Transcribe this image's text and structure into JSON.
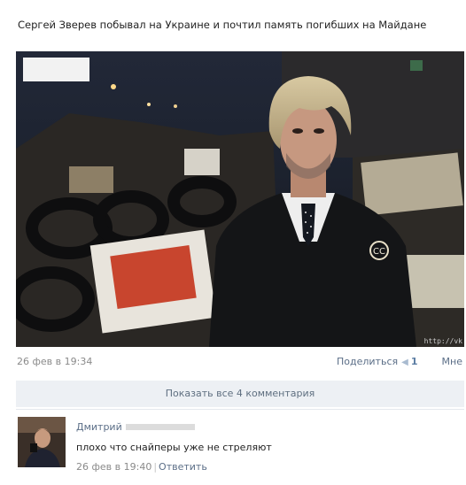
{
  "post": {
    "title": "Сергей Зверев побывал на Украине и почтил память погибших на Майдане",
    "date": "26 фев в 19:34",
    "share_label": "Поделиться",
    "share_count": "1",
    "like_label": "Мне",
    "watermark": "http://vk"
  },
  "comments_bar": {
    "label": "Показать все 4 комментария"
  },
  "comment": {
    "author": "Дмитрий",
    "text": "плохо что снайперы уже не стреляют",
    "date": "26 фев в 19:40",
    "reply_label": "Ответить"
  },
  "icons": {
    "share": "megaphone-icon",
    "badge": "chanel-brooch-icon"
  },
  "colors": {
    "link": "#5b6e87",
    "bar_bg": "#edf0f4",
    "muted": "#8a8a8a"
  }
}
